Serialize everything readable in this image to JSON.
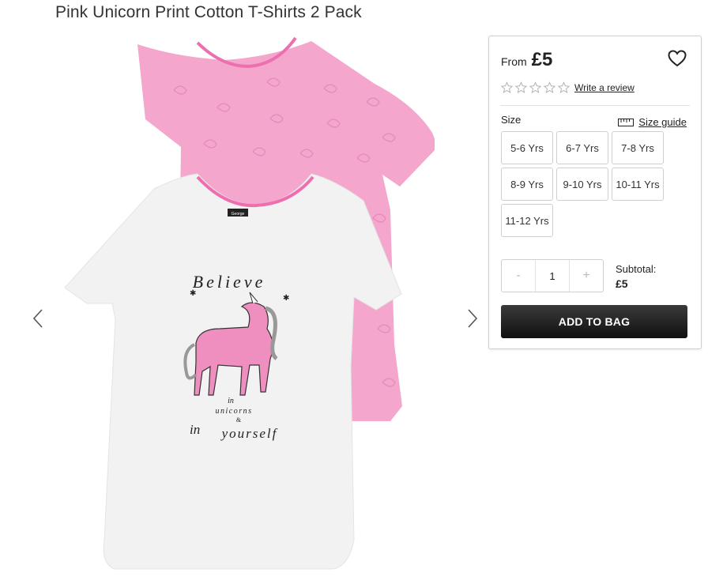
{
  "product": {
    "title": "Pink Unicorn Print Cotton T-Shirts 2 Pack",
    "image_text": {
      "label": "George",
      "believe": "Believe",
      "in": "in",
      "unicorns": "unicorns",
      "amp": "&",
      "in2": "in",
      "yourself": "yourself"
    }
  },
  "gallery": {
    "prev_icon": "chevron-left-icon",
    "next_icon": "chevron-right-icon"
  },
  "panel": {
    "from_label": "From",
    "price": "£5",
    "wishlist_icon": "heart-icon",
    "rating": {
      "stars": 0,
      "max": 5,
      "review_link": "Write a review"
    },
    "size": {
      "label": "Size",
      "guide_label": "Size guide",
      "guide_icon": "ruler-icon",
      "options": [
        "5-6 Yrs",
        "6-7 Yrs",
        "7-8 Yrs",
        "8-9 Yrs",
        "9-10 Yrs",
        "10-11 Yrs",
        "11-12 Yrs"
      ]
    },
    "quantity": {
      "minus": "-",
      "value": "1",
      "plus": "+"
    },
    "subtotal": {
      "label": "Subtotal:",
      "amount": "£5"
    },
    "add_to_bag": "ADD TO BAG"
  },
  "colors": {
    "pink_shirt": "#f4a6cc",
    "white_shirt": "#f2f2f2",
    "button_dark": "#1c1c1c",
    "unicorn_pink": "#ee8fbf"
  }
}
